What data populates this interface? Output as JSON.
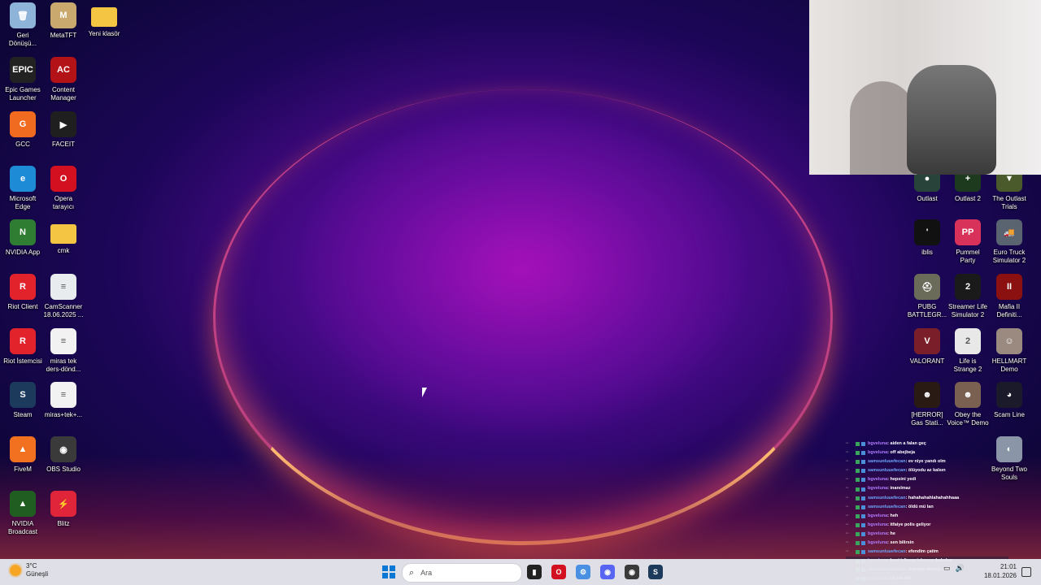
{
  "desktop": {
    "icons_left": [
      {
        "label": "Geri\nDönüşü...",
        "icon": "recycle-bin-icon",
        "color": "#8fb4d9",
        "glyph": "🗑"
      },
      {
        "label": "MetaTFT",
        "icon": "metatft-icon",
        "color": "#c9a96e",
        "glyph": "M"
      },
      {
        "label": "Yeni klasör",
        "icon": "folder-icon",
        "color": "#f4c542",
        "glyph": ""
      },
      {
        "label": "Epic Games\nLauncher",
        "icon": "epic-games-icon",
        "color": "#222222",
        "glyph": "EPIC"
      },
      {
        "label": "Content\nManager",
        "icon": "content-manager-icon",
        "color": "#b31217",
        "glyph": "AC"
      },
      {
        "label": "GCC",
        "icon": "gcc-icon",
        "color": "#f06a1f",
        "glyph": "G"
      },
      {
        "label": "FACEIT",
        "icon": "faceit-icon",
        "color": "#1f1f1f",
        "glyph": "▶"
      },
      {
        "label": "Microsoft\nEdge",
        "icon": "edge-icon",
        "color": "#1e8bd6",
        "glyph": "e"
      },
      {
        "label": "Opera\ntarayıcı",
        "icon": "opera-icon",
        "color": "#d2101f",
        "glyph": "O"
      },
      {
        "label": "NVIDIA App",
        "icon": "nvidia-app-icon",
        "color": "#2e7d32",
        "glyph": "N"
      },
      {
        "label": "cmk",
        "icon": "folder-icon",
        "color": "#f4c542",
        "glyph": ""
      },
      {
        "label": "Riot Client",
        "icon": "riot-client-icon",
        "color": "#e3232c",
        "glyph": "R"
      },
      {
        "label": "CamScanner\n18.06.2025 ...",
        "icon": "document-icon",
        "color": "#e9ecef",
        "glyph": "≡"
      },
      {
        "label": "Riot İstemcisi",
        "icon": "riot-client-icon",
        "color": "#e3232c",
        "glyph": "R"
      },
      {
        "label": "miras tek\nders-dönd...",
        "icon": "document-icon",
        "color": "#f2f2f2",
        "glyph": "≡"
      },
      {
        "label": "Steam",
        "icon": "steam-icon",
        "color": "#1b3a5c",
        "glyph": "S"
      },
      {
        "label": "miras+tek+...",
        "icon": "document-icon",
        "color": "#f2f2f2",
        "glyph": "≡"
      },
      {
        "label": "FiveM",
        "icon": "fivem-icon",
        "color": "#f27121",
        "glyph": "▲"
      },
      {
        "label": "OBS Studio",
        "icon": "obs-icon",
        "color": "#3a3a3a",
        "glyph": "◉"
      },
      {
        "label": "NVIDIA\nBroadcast",
        "icon": "nvidia-broadcast-icon",
        "color": "#1f5e20",
        "glyph": "▲"
      },
      {
        "label": "Blitz",
        "icon": "blitz-icon",
        "color": "#e0243a",
        "glyph": "⚡"
      }
    ],
    "icons_right": [
      {
        "label": "Outlast",
        "icon": "outlast-icon",
        "color": "#27433a",
        "glyph": "●"
      },
      {
        "label": "Outlast 2",
        "icon": "outlast2-icon",
        "color": "#1e3a1e",
        "glyph": "+"
      },
      {
        "label": "The Outlast\nTrials",
        "icon": "outlast-trials-icon",
        "color": "#4a5a2a",
        "glyph": "▼"
      },
      {
        "label": "iblis",
        "icon": "iblis-icon",
        "color": "#111111",
        "glyph": "'"
      },
      {
        "label": "Pummel\nParty",
        "icon": "pummel-party-icon",
        "color": "#d8325a",
        "glyph": "PP"
      },
      {
        "label": "Euro Truck\nSimulator 2",
        "icon": "euro-truck-icon",
        "color": "#5a6470",
        "glyph": "🚚"
      },
      {
        "label": "PUBG\nBATTLEGR...",
        "icon": "pubg-icon",
        "color": "#6b6b5a",
        "glyph": "⛑"
      },
      {
        "label": "Streamer Life\nSimulator 2",
        "icon": "streamer-life-icon",
        "color": "#1a1a1a",
        "glyph": "2"
      },
      {
        "label": "Mafia II\nDefiniti...",
        "icon": "mafia-icon",
        "color": "#8b1010",
        "glyph": "II"
      },
      {
        "label": "VALORANT",
        "icon": "valorant-icon",
        "color": "#7a1f2a",
        "glyph": "V"
      },
      {
        "label": "Life is\nStrange 2",
        "icon": "life-is-strange-icon",
        "color": "#e8e8e8",
        "glyph": "2"
      },
      {
        "label": "HELLMART\nDemo",
        "icon": "hellmart-icon",
        "color": "#9a8a80",
        "glyph": "☺"
      },
      {
        "label": "[HERROR]\nGas Stati...",
        "icon": "herror-icon",
        "color": "#2a1a14",
        "glyph": "☻"
      },
      {
        "label": "Obey the\nVoice™ Demo",
        "icon": "obey-voice-icon",
        "color": "#7a6050",
        "glyph": "☻"
      },
      {
        "label": "Scam Line",
        "icon": "scam-line-icon",
        "color": "#1a1a2a",
        "glyph": "◕"
      },
      {
        "label": "Beyond Two\nSouls",
        "icon": "beyond-two-souls-icon",
        "color": "#8a96a8",
        "glyph": "◐"
      }
    ]
  },
  "chat": [
    {
      "user": "bgveluna",
      "msg": ": aiden a falan geç"
    },
    {
      "user": "bgveluna",
      "msg": ": off abejbeja"
    },
    {
      "user": "samsunluuefecan",
      "msg": ": ev niye yandı olm"
    },
    {
      "user": "samsunluuefecan",
      "msg": ": ölüyodu az kalsın"
    },
    {
      "user": "bgveluna",
      "msg": ": hepsini yedi"
    },
    {
      "user": "bgveluna",
      "msg": ": inanılmaz"
    },
    {
      "user": "samsunluuefecan",
      "msg": ": hahahahahlahahahhaaa"
    },
    {
      "user": "samsunluuefecan",
      "msg": ": öldü mü lan"
    },
    {
      "user": "bgveluna",
      "msg": ": heh"
    },
    {
      "user": "bgveluna",
      "msg": ": itfaiye polis geliyor"
    },
    {
      "user": "bgveluna",
      "msg": ": he"
    },
    {
      "user": "bgveluna",
      "msg": ": sen bilirsin"
    },
    {
      "user": "samsunluuefecan",
      "msg": ": efendim çatim"
    },
    {
      "user": "bgveluna",
      "msg": ": beni izlicem tekrarını bakalım"
    },
    {
      "user": "samsunluuefecan",
      "msg": ": onkadar kısarla amk"
    },
    {
      "user": "bgveluna",
      "msg": ": git ise abi"
    }
  ],
  "taskbar": {
    "weather_temp": "3°C",
    "weather_desc": "Güneşli",
    "search_placeholder": "Ara",
    "time": "21:01",
    "date": "18.01.2026",
    "apps": [
      {
        "name": "file-explorer-icon",
        "color": "#f4c542",
        "glyph": ""
      },
      {
        "name": "terminal-icon",
        "color": "#222222",
        "glyph": "▮"
      },
      {
        "name": "opera-taskbar-icon",
        "color": "#d2101f",
        "glyph": "O"
      },
      {
        "name": "settings-taskbar-icon",
        "color": "#4a90e2",
        "glyph": "⚙"
      },
      {
        "name": "discord-taskbar-icon",
        "color": "#5865f2",
        "glyph": "◉"
      },
      {
        "name": "obs-taskbar-icon",
        "color": "#3a3a3a",
        "glyph": "◉"
      },
      {
        "name": "steam-taskbar-icon",
        "color": "#1b3a5c",
        "glyph": "S"
      }
    ]
  }
}
